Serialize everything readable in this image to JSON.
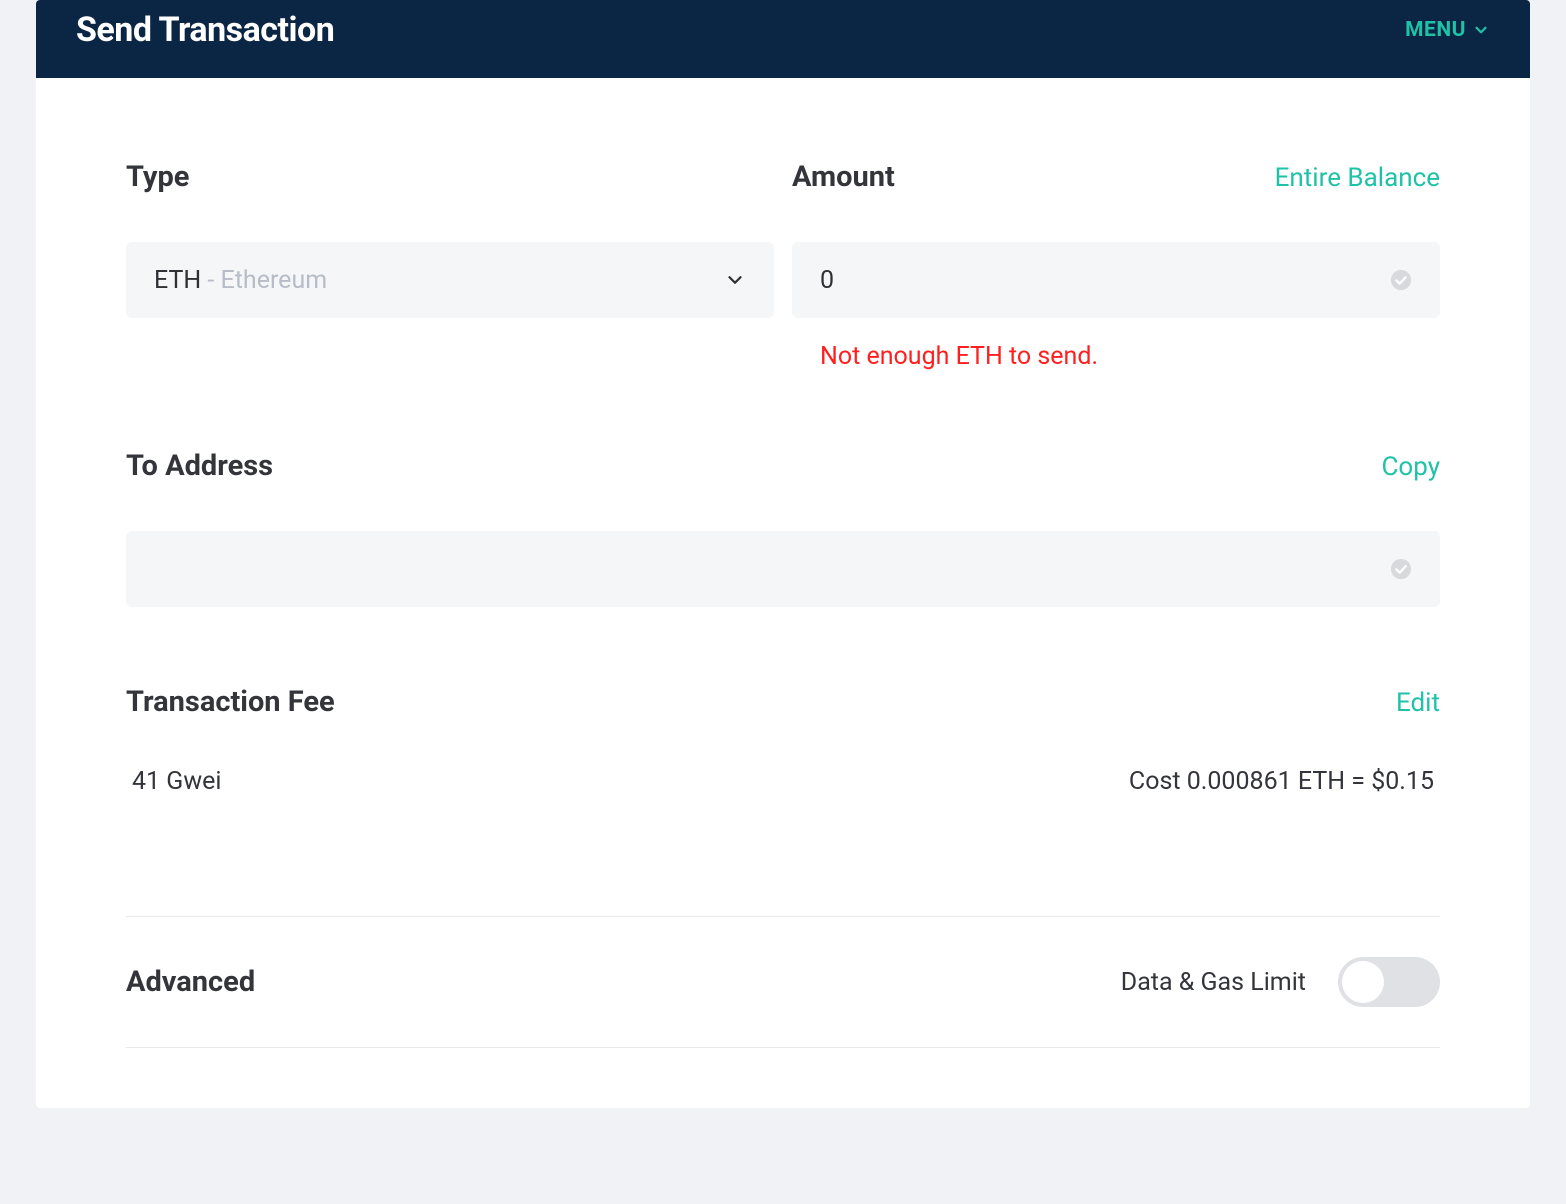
{
  "header": {
    "title": "Send Transaction",
    "menu_label": "MENU"
  },
  "type": {
    "label": "Type",
    "selected_symbol": "ETH",
    "selected_name": "- Ethereum"
  },
  "amount": {
    "label": "Amount",
    "entire_balance_label": "Entire Balance",
    "value": "0",
    "error": "Not enough ETH to send."
  },
  "to_address": {
    "label": "To Address",
    "copy_label": "Copy",
    "value": ""
  },
  "fee": {
    "label": "Transaction Fee",
    "edit_label": "Edit",
    "gwei": "41 Gwei",
    "cost": "Cost 0.000861 ETH = $0.15"
  },
  "advanced": {
    "label": "Advanced",
    "toggle_label": "Data & Gas Limit",
    "toggle_on": false
  }
}
